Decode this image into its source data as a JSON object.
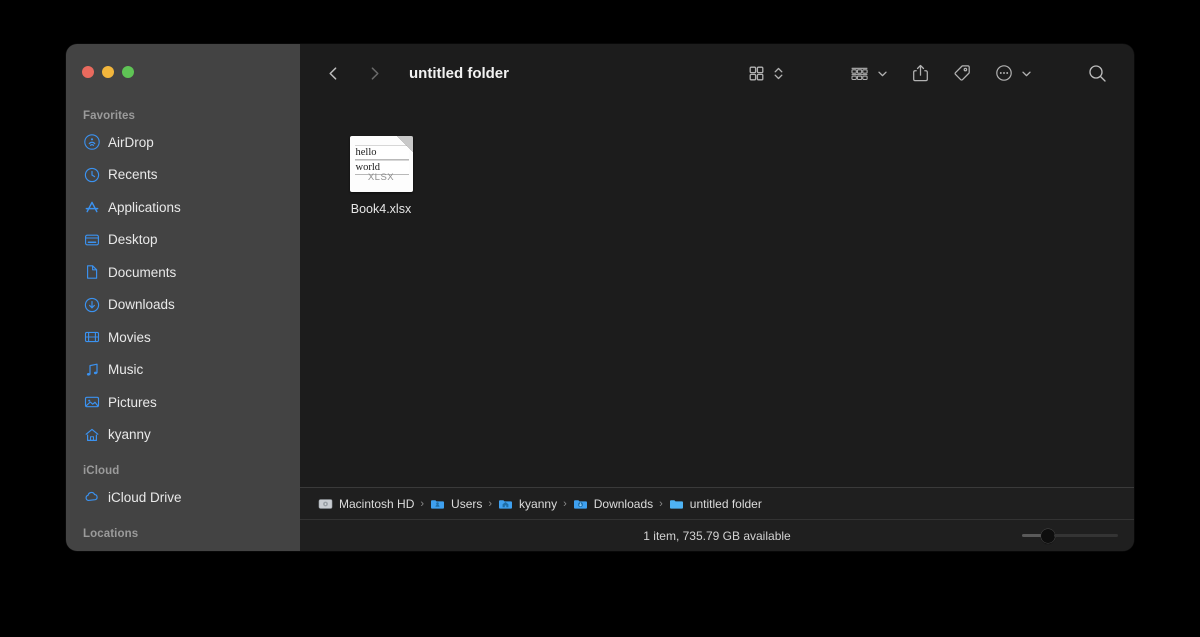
{
  "window": {
    "title": "untitled folder",
    "traffic_lights": [
      {
        "name": "close",
        "color": "#e96a5e"
      },
      {
        "name": "minimize",
        "color": "#f2b63c"
      },
      {
        "name": "maximize",
        "color": "#5fc455"
      }
    ]
  },
  "sidebar": {
    "groups": [
      {
        "title": "Favorites",
        "items": [
          {
            "label": "AirDrop",
            "icon": "airdrop-icon"
          },
          {
            "label": "Recents",
            "icon": "clock-icon"
          },
          {
            "label": "Applications",
            "icon": "applications-icon"
          },
          {
            "label": "Desktop",
            "icon": "desktop-icon"
          },
          {
            "label": "Documents",
            "icon": "document-icon"
          },
          {
            "label": "Downloads",
            "icon": "download-icon"
          },
          {
            "label": "Movies",
            "icon": "film-icon"
          },
          {
            "label": "Music",
            "icon": "music-note-icon"
          },
          {
            "label": "Pictures",
            "icon": "photo-icon"
          },
          {
            "label": "kyanny",
            "icon": "home-icon"
          }
        ]
      },
      {
        "title": "iCloud",
        "items": [
          {
            "label": "iCloud Drive",
            "icon": "cloud-icon"
          }
        ]
      },
      {
        "title": "Locations",
        "items": []
      }
    ],
    "accent_color": "#3b92f0"
  },
  "toolbar": {
    "back": "back-chevron-icon",
    "forward": "forward-chevron-icon",
    "view_mode": "icon-view-icon",
    "view_stepper": "up-down-chevron-icon",
    "group_by": "group-by-icon",
    "group_chevron": "chevron-down-icon",
    "share": "share-icon",
    "tag": "tag-icon",
    "more": "more-ellipsis-icon",
    "more_chevron": "chevron-down-icon",
    "search": "search-icon"
  },
  "files": [
    {
      "name": "Book4.xlsx",
      "kind": "XLSX",
      "preview_lines": [
        "hello",
        "world"
      ],
      "selected": false
    }
  ],
  "path_bar": {
    "crumbs": [
      {
        "label": "Macintosh HD",
        "icon": "hard-drive-icon"
      },
      {
        "label": "Users",
        "icon": "users-folder-icon"
      },
      {
        "label": "kyanny",
        "icon": "home-folder-icon"
      },
      {
        "label": "Downloads",
        "icon": "downloads-folder-icon"
      },
      {
        "label": "untitled folder",
        "icon": "folder-icon"
      }
    ],
    "separator": "›"
  },
  "status_bar": {
    "text": "1 item, 735.79 GB available",
    "zoom_slider_value": 20
  }
}
